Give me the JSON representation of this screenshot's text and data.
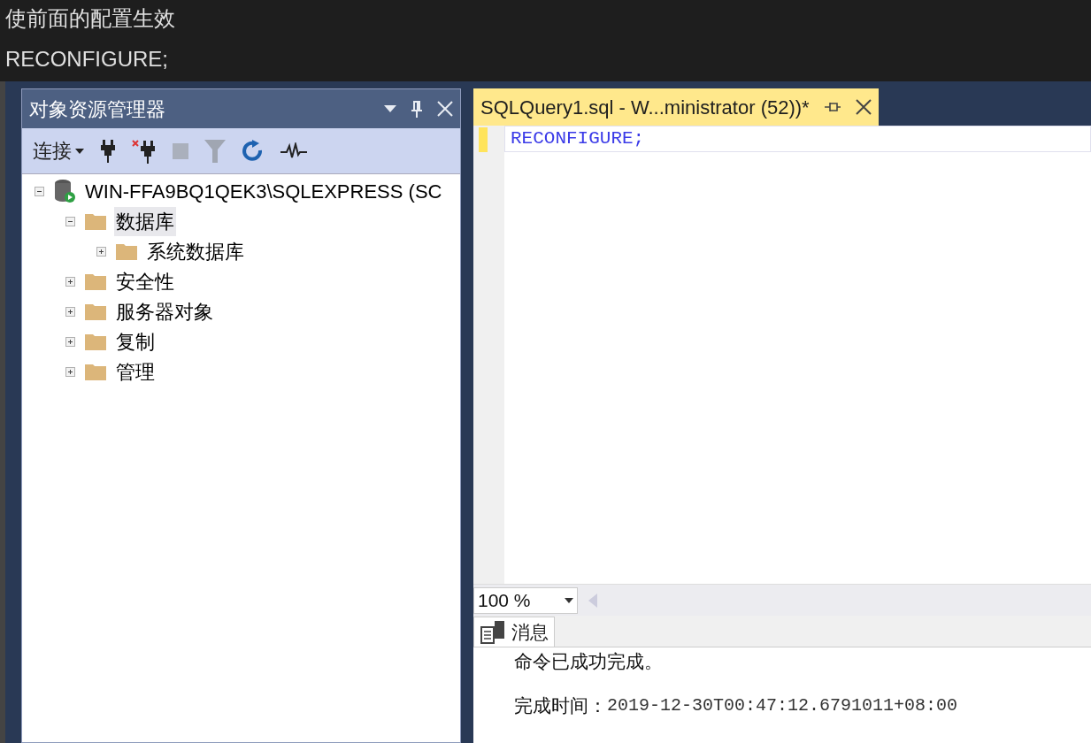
{
  "article": {
    "lines": [
      "使前面的配置生效",
      "RECONFIGURE;"
    ]
  },
  "object_explorer": {
    "title": "对象资源管理器",
    "toolbar": {
      "connect_label": "连接"
    },
    "tree": [
      {
        "label": "WIN-FFA9BQ1QEK3\\SQLEXPRESS (SC",
        "kind": "server",
        "expanded": true,
        "selected": false,
        "children": [
          {
            "label": "数据库",
            "kind": "folder",
            "expanded": true,
            "selected": true,
            "children": [
              {
                "label": "系统数据库",
                "kind": "folder",
                "expanded": false,
                "selected": false
              }
            ]
          },
          {
            "label": "安全性",
            "kind": "folder",
            "expanded": false,
            "selected": false
          },
          {
            "label": "服务器对象",
            "kind": "folder",
            "expanded": false,
            "selected": false
          },
          {
            "label": "复制",
            "kind": "folder",
            "expanded": false,
            "selected": false
          },
          {
            "label": "管理",
            "kind": "folder",
            "expanded": false,
            "selected": false
          }
        ]
      }
    ]
  },
  "editor": {
    "tab": {
      "title": "SQLQuery1.sql - W...ministrator (52))*",
      "selected": true
    },
    "code_lines": [
      "RECONFIGURE;"
    ],
    "zoom": "100 %",
    "results": {
      "tab": {
        "label": "消息",
        "selected": true
      },
      "message": "命令已成功完成。",
      "completion_label": "完成时间：",
      "completion_time": "2019-12-30T00:47:12.6791011+08:00"
    }
  }
}
